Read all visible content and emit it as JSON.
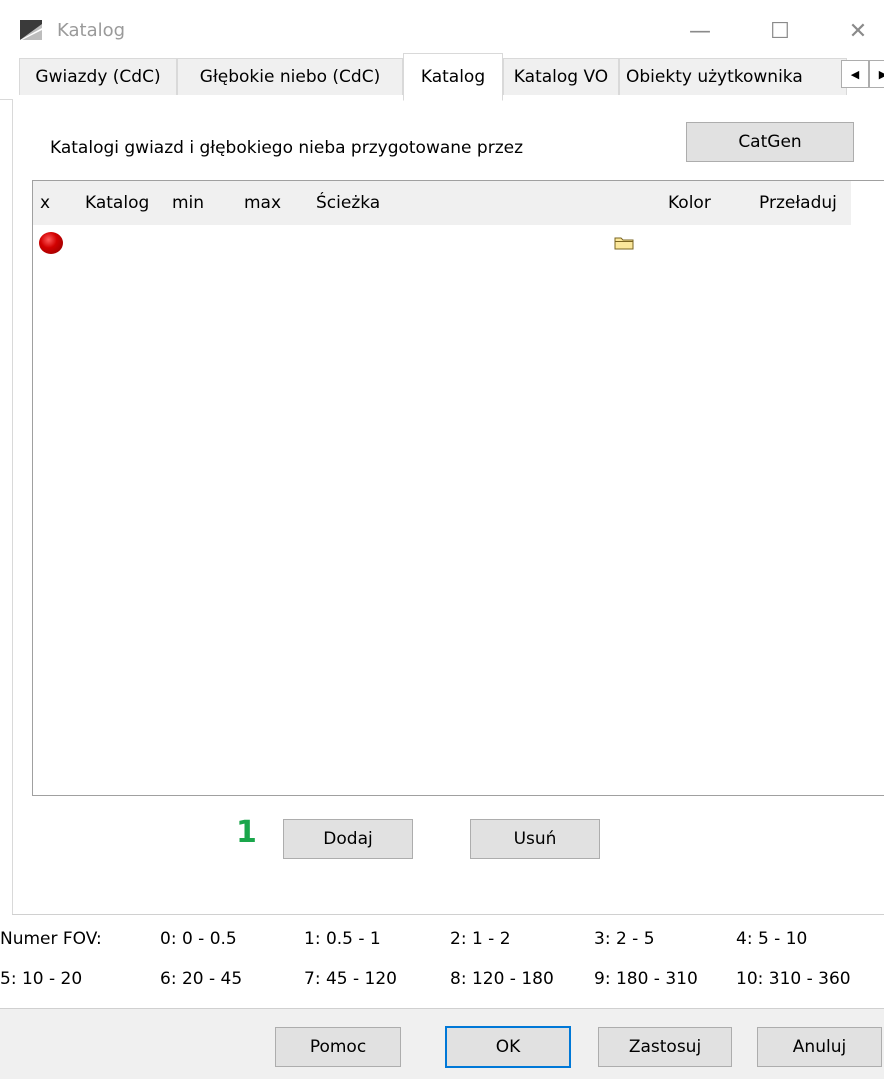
{
  "window": {
    "title": "Katalog",
    "minimize": "—",
    "maximize": "☐",
    "close": "✕"
  },
  "tabs": [
    {
      "label": "Gwiazdy (CdC)"
    },
    {
      "label": "Głębokie niebo (CdC)"
    },
    {
      "label": "Katalog",
      "active": true
    },
    {
      "label": "Katalog VO"
    },
    {
      "label": "Obiekty użytkownika"
    }
  ],
  "tab_scroll": {
    "left": "◀",
    "right": "▶"
  },
  "description": "Katalogi gwiazd i głębokiego nieba przygotowane przez",
  "catgen_button": "CatGen",
  "grid": {
    "columns": [
      "x",
      "Katalog",
      "min",
      "max",
      "Ścieżka",
      "Kolor",
      "Przeładuj"
    ],
    "rows": [
      {
        "x": "",
        "catalog": "",
        "min": "",
        "max": "",
        "path": "",
        "color": "",
        "reload": ""
      }
    ]
  },
  "marker": "1",
  "add_button": "Dodaj",
  "remove_button": "Usuń",
  "fov": {
    "label": "Numer FOV:",
    "ranges": [
      "0: 0 - 0.5",
      "1: 0.5 - 1",
      "2: 1 - 2",
      "3: 2 - 5",
      "4: 5 - 10",
      "5: 10 - 20",
      "6: 20 - 45",
      "7: 45 - 120",
      "8: 120 - 180",
      "9: 180 - 310",
      "10: 310 - 360"
    ]
  },
  "footer": {
    "help": "Pomoc",
    "ok": "OK",
    "apply": "Zastosuj",
    "cancel": "Anuluj"
  },
  "colors": {
    "accent": "#0078d7",
    "marker": "#1aa64b",
    "status_dot": "#d20000"
  }
}
